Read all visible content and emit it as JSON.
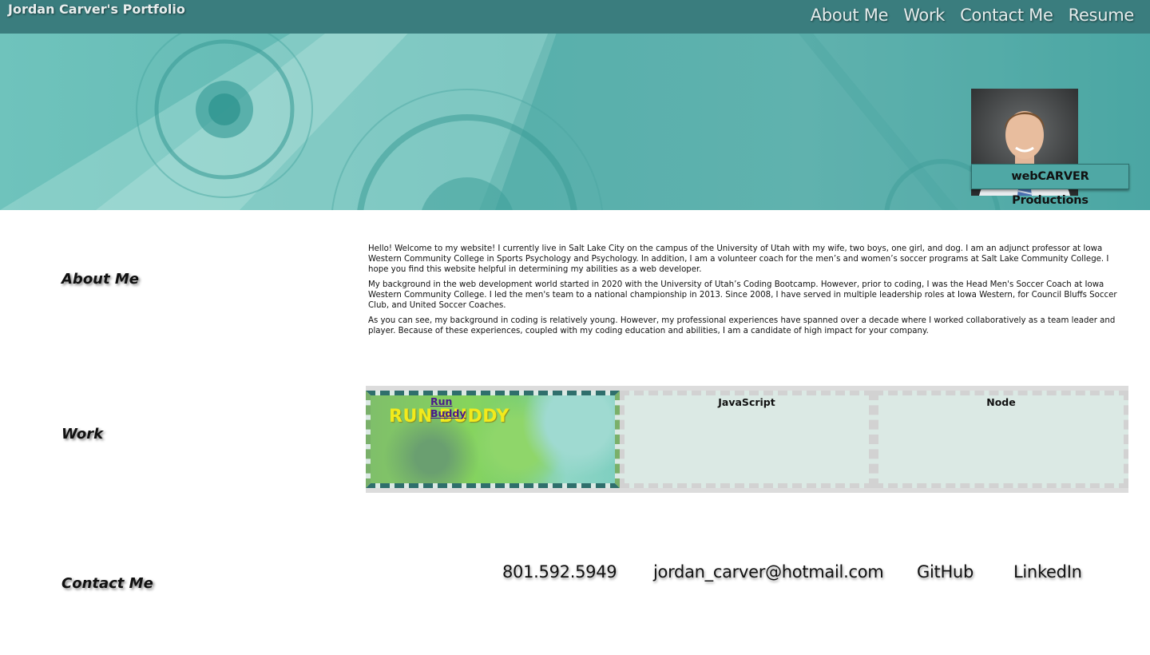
{
  "header": {
    "site_title": "Jordan Carver's Portfolio",
    "nav": [
      "About Me",
      "Work",
      "Contact Me",
      "Resume"
    ]
  },
  "hero": {
    "portrait_alt": "portrait-photo",
    "badge": "webCARVER Productions"
  },
  "about": {
    "heading": "About Me",
    "paragraphs": [
      "Hello! Welcome to my website! I currently live in Salt Lake City on the campus of the University of Utah with my wife, two boys, one girl, and dog. I am an adjunct professor at Iowa Western Community College in Sports Psychology and Psychology. In addition, I am a volunteer coach for the men’s and women’s soccer programs at Salt Lake Community College. I hope you find this website helpful in determining my abilities as a web developer.",
      "My background in the web development world started in 2020 with the University of Utah’s Coding Bootcamp. However, prior to coding, I was the Head Men's Soccer Coach at Iowa Western Community College. I led the men's team to a national championship in 2013. Since 2008, I have served in multiple leadership roles at Iowa Western, for Council Bluffs Soccer Club, and United Soccer Coaches.",
      "As you can see, my background in coding is relatively young. However, my professional experiences have spanned over a decade where I worked collaboratively as a team leader and player. Because of these experiences, coupled with my coding education and abilities, I am a candidate of high impact for your company."
    ]
  },
  "work": {
    "heading": "Work",
    "cards": [
      {
        "title": "Run Buddy",
        "image_text": "RUN BUDDY"
      },
      {
        "title": "JavaScript"
      },
      {
        "title": "Node"
      }
    ]
  },
  "contact": {
    "heading": "Contact Me",
    "phone": "801.592.5949",
    "email": "jordan_carver@hotmail.com",
    "github": "GitHub",
    "linkedin": "LinkedIn"
  },
  "colors": {
    "topbar": "#3a7d7e",
    "hero": "#5eb5b0",
    "badge": "#4fa8a5",
    "card": "#dbe9e4"
  }
}
